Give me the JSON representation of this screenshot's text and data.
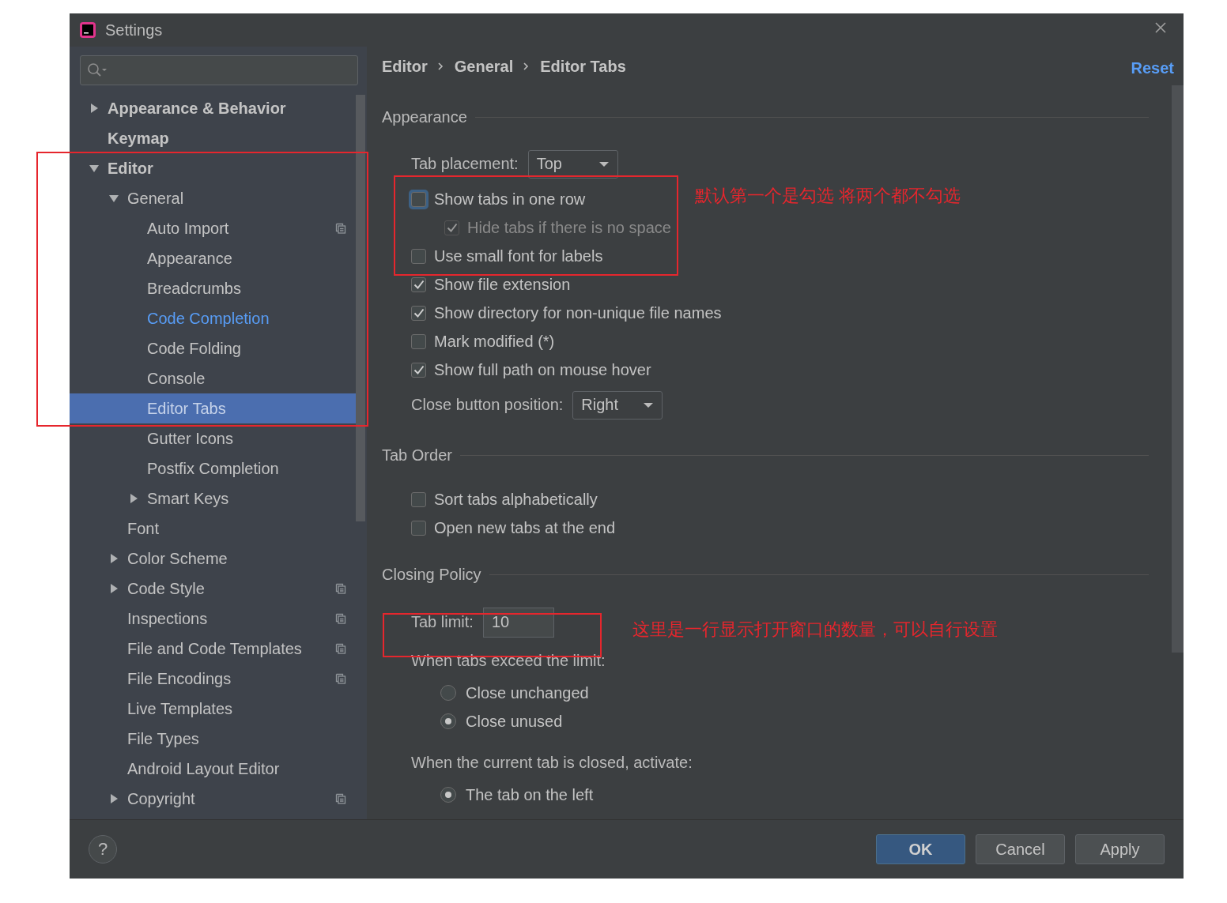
{
  "window": {
    "title": "Settings"
  },
  "sidebar": {
    "items": [
      {
        "label": "Appearance & Behavior",
        "bold": true,
        "expanded": false,
        "selected": false,
        "modified": false,
        "project": false
      },
      {
        "label": "Keymap",
        "bold": true,
        "selected": false,
        "modified": false,
        "project": false
      },
      {
        "label": "Editor",
        "bold": true,
        "expanded": true,
        "selected": false,
        "modified": false,
        "project": false,
        "children": [
          {
            "label": "General",
            "bold": false,
            "expanded": true,
            "selected": false,
            "modified": false,
            "project": false,
            "children": [
              {
                "label": "Auto Import",
                "bold": false,
                "selected": false,
                "modified": false,
                "project": true
              },
              {
                "label": "Appearance",
                "bold": false,
                "selected": false,
                "modified": false,
                "project": false
              },
              {
                "label": "Breadcrumbs",
                "bold": false,
                "selected": false,
                "modified": false,
                "project": false
              },
              {
                "label": "Code Completion",
                "bold": false,
                "selected": false,
                "modified": true,
                "project": false
              },
              {
                "label": "Code Folding",
                "bold": false,
                "selected": false,
                "modified": false,
                "project": false
              },
              {
                "label": "Console",
                "bold": false,
                "selected": false,
                "modified": false,
                "project": false
              },
              {
                "label": "Editor Tabs",
                "bold": false,
                "selected": true,
                "modified": false,
                "project": false
              },
              {
                "label": "Gutter Icons",
                "bold": false,
                "selected": false,
                "modified": false,
                "project": false
              },
              {
                "label": "Postfix Completion",
                "bold": false,
                "selected": false,
                "modified": false,
                "project": false
              },
              {
                "label": "Smart Keys",
                "bold": false,
                "expanded": false,
                "selected": false,
                "modified": false,
                "project": false
              }
            ]
          },
          {
            "label": "Font",
            "bold": false,
            "selected": false,
            "modified": false,
            "project": false
          },
          {
            "label": "Color Scheme",
            "bold": false,
            "expanded": false,
            "selected": false,
            "modified": false,
            "project": false
          },
          {
            "label": "Code Style",
            "bold": false,
            "expanded": false,
            "selected": false,
            "modified": false,
            "project": true
          },
          {
            "label": "Inspections",
            "bold": false,
            "selected": false,
            "modified": false,
            "project": true
          },
          {
            "label": "File and Code Templates",
            "bold": false,
            "selected": false,
            "modified": false,
            "project": true
          },
          {
            "label": "File Encodings",
            "bold": false,
            "selected": false,
            "modified": false,
            "project": true
          },
          {
            "label": "Live Templates",
            "bold": false,
            "selected": false,
            "modified": false,
            "project": false
          },
          {
            "label": "File Types",
            "bold": false,
            "selected": false,
            "modified": false,
            "project": false
          },
          {
            "label": "Android Layout Editor",
            "bold": false,
            "selected": false,
            "modified": false,
            "project": false
          },
          {
            "label": "Copyright",
            "bold": false,
            "expanded": false,
            "selected": false,
            "modified": false,
            "project": true
          }
        ]
      }
    ]
  },
  "breadcrumbs": [
    "Editor",
    "General",
    "Editor Tabs"
  ],
  "reset": "Reset",
  "sections": [
    {
      "title": "Appearance",
      "rows": [
        {
          "kind": "dropdown",
          "label": "Tab placement:",
          "value": "Top"
        },
        {
          "kind": "checkbox",
          "label": "Show tabs in one row",
          "checked": false,
          "focused": true,
          "disabled": false,
          "children": [
            {
              "kind": "checkbox",
              "label": "Hide tabs if there is no space",
              "checked": true,
              "focused": false,
              "disabled": true
            }
          ]
        },
        {
          "kind": "checkbox",
          "label": "Use small font for labels",
          "checked": false,
          "focused": false,
          "disabled": false
        },
        {
          "kind": "checkbox",
          "label": "Show file extension",
          "checked": true,
          "focused": false,
          "disabled": false
        },
        {
          "kind": "checkbox",
          "label": "Show directory for non-unique file names",
          "checked": true,
          "focused": false,
          "disabled": false
        },
        {
          "kind": "checkbox",
          "label": "Mark modified (*)",
          "checked": false,
          "focused": false,
          "disabled": false
        },
        {
          "kind": "checkbox",
          "label": "Show full path on mouse hover",
          "checked": true,
          "focused": false,
          "disabled": false
        },
        {
          "kind": "dropdown",
          "label": "Close button position:",
          "value": "Right"
        }
      ]
    },
    {
      "title": "Tab Order",
      "rows": [
        {
          "kind": "checkbox",
          "label": "Sort tabs alphabetically",
          "checked": false,
          "focused": false,
          "disabled": false
        },
        {
          "kind": "checkbox",
          "label": "Open new tabs at the end",
          "checked": false,
          "focused": false,
          "disabled": false
        }
      ]
    },
    {
      "title": "Closing Policy",
      "rows": [
        {
          "kind": "field",
          "label": "Tab limit:",
          "value": "10"
        },
        {
          "kind": "caption",
          "label": "When tabs exceed the limit:",
          "options": [
            {
              "label": "Close unchanged",
              "selected": false
            },
            {
              "label": "Close unused",
              "selected": true
            }
          ]
        },
        {
          "kind": "caption",
          "label": "When the current tab is closed, activate:",
          "options": [
            {
              "label": "The tab on the left",
              "selected": true
            }
          ]
        }
      ]
    }
  ],
  "buttons": [
    {
      "label": "OK",
      "default": true
    },
    {
      "label": "Cancel",
      "default": false
    },
    {
      "label": "Apply",
      "default": false
    }
  ],
  "help": "?",
  "notes": [
    "默认第一个是勾选 将两个都不勾选",
    "这里是一行显示打开窗口的数量，可以自行设置"
  ]
}
